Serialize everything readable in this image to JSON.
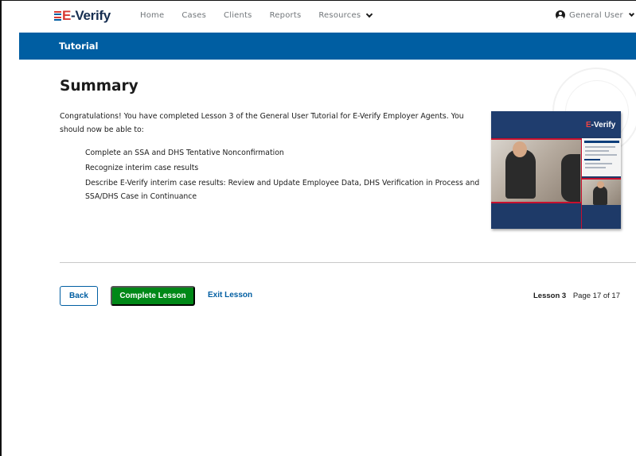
{
  "topnav": {
    "logo_text_e": "E",
    "logo_text_rest": "Verify",
    "links": [
      "Home",
      "Cases",
      "Clients",
      "Reports",
      "Resources"
    ],
    "user_name": "General User"
  },
  "banner": {
    "title": "Tutorial"
  },
  "main": {
    "title": "Summary",
    "intro": "Congratulations! You have completed Lesson 3 of the General User Tutorial for E-Verify Employer Agents. You should now be able to:",
    "objectives": [
      "Complete an SSA and DHS Tentative Nonconfirmation",
      "Recognize interim case results",
      "Describe E-Verify interim case results: Review and Update Employee Data, DHS Verification in Process and SSA/DHS Case in Continuance"
    ],
    "cover_logo_e": "E",
    "cover_logo_rest": "Verify"
  },
  "footer": {
    "back_label": "Back",
    "complete_label": "Complete Lesson",
    "exit_label": "Exit Lesson",
    "lesson_label": "Lesson 3",
    "page_label": "Page 17 of 17"
  },
  "colors": {
    "brand_blue": "#005ea2",
    "navy": "#162e51",
    "success_green": "#008817",
    "accent_red": "#d83933"
  },
  "icons": {
    "user": "user-circle-icon",
    "dropdown": "chevron-down-icon"
  }
}
